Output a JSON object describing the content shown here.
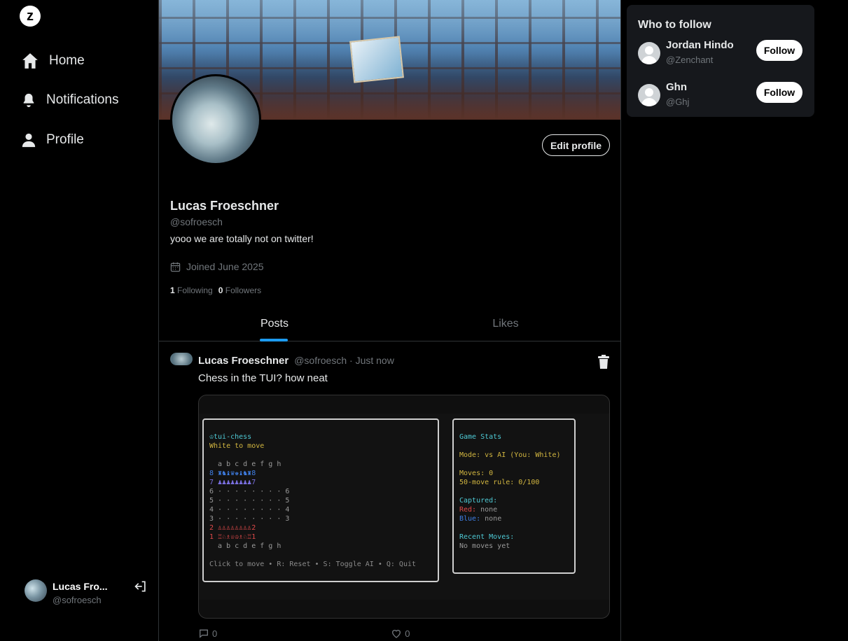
{
  "app": {
    "logo_glyph": "z"
  },
  "sidebar": {
    "items": [
      {
        "label": "Home",
        "icon": "home-icon"
      },
      {
        "label": "Notifications",
        "icon": "bell-icon"
      },
      {
        "label": "Profile",
        "icon": "user-icon"
      }
    ],
    "account": {
      "name": "Lucas Fro...",
      "handle": "@sofroesch",
      "logout_icon": "logout-icon"
    }
  },
  "profile": {
    "edit_label": "Edit profile",
    "name": "Lucas Froeschner",
    "handle": "@sofroesch",
    "bio": "yooo we are totally not on twitter!",
    "joined": "Joined June 2025",
    "following_count": "1",
    "following_label": "Following",
    "followers_count": "0",
    "followers_label": "Followers"
  },
  "tabs": [
    {
      "label": "Posts",
      "active": true
    },
    {
      "label": "Likes",
      "active": false
    }
  ],
  "post": {
    "author": "Lucas Froeschner",
    "meta": "@sofroesch · Just now",
    "text": "Chess in the TUI? how neat",
    "reply_count": "0",
    "like_count": "0",
    "terminal": {
      "title": "♔tui-chess",
      "status": "White to move",
      "files": "  a b c d e f g h",
      "rank8": "8 ♜♞♝♛♚♝♞♜8",
      "rank7": "7 ♟♟♟♟♟♟♟♟7",
      "rank6": "6 · · · · · · · · 6",
      "rank5": "5 · · · · · · · · 5",
      "rank4": "4 · · · · · · · · 4",
      "rank3": "3 · · · · · · · · 3",
      "rank2": "2 ♙♙♙♙♙♙♙♙2",
      "rank1": "1 ♖♘♗♕♔♗♘♖1",
      "files_bottom": "  a b c d e f g h",
      "help": "Click to move • R: Reset • S: Toggle AI • Q: Quit",
      "stats_title": "Game Stats",
      "mode": "Mode: vs AI (You: White)",
      "moves": "Moves: 0",
      "fifty": "50-move rule: 0/100",
      "captured_label": "Captured:",
      "red_label": "Red:",
      "red_value": " none",
      "blue_label": "Blue:",
      "blue_value": " none",
      "recent_label": "Recent Moves:",
      "recent_value": "No moves yet"
    }
  },
  "who_to_follow": {
    "title": "Who to follow",
    "users": [
      {
        "name": "Jordan Hindo",
        "handle": "@Zenchant",
        "button": "Follow"
      },
      {
        "name": "Ghn",
        "handle": "@Ghj",
        "button": "Follow"
      }
    ]
  },
  "colors": {
    "accent": "#1d9bf0",
    "background": "#000000",
    "muted": "#71767b"
  }
}
